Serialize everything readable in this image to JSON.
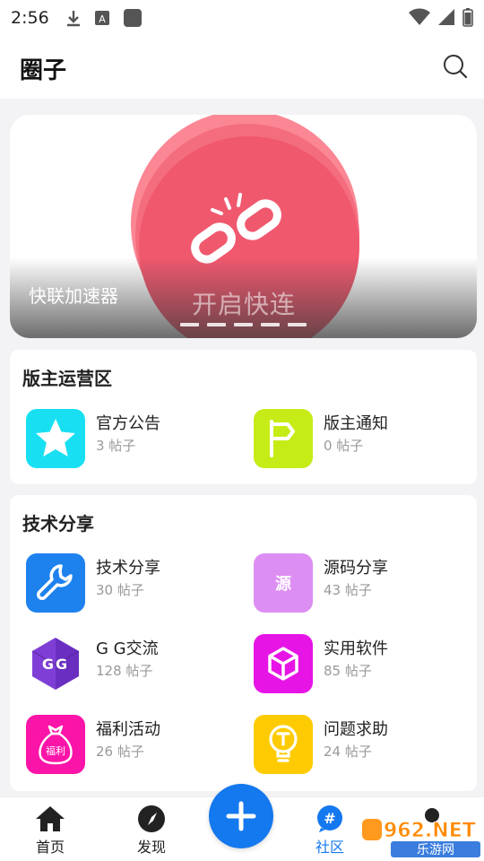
{
  "status": {
    "time": "2:56"
  },
  "header": {
    "title": "圈子"
  },
  "banner": {
    "label": "快联加速器",
    "cta": "开启快连"
  },
  "section1": {
    "title": "版主运营区",
    "items": [
      {
        "name": "官方公告",
        "count": "3 帖子",
        "icon": "star-icon",
        "color": "#18e0f2"
      },
      {
        "name": "版主通知",
        "count": "0 帖子",
        "icon": "flag-icon",
        "color": "#c6ec17"
      }
    ]
  },
  "section2": {
    "title": "技术分享",
    "items": [
      {
        "name": "技术分享",
        "count": "30 帖子",
        "icon": "wrench-icon",
        "color": "#1e82ee"
      },
      {
        "name": "源码分享",
        "count": "43 帖子",
        "icon": "source-icon",
        "color": "#dd8ef3",
        "icon_text": "源"
      },
      {
        "name": "G G交流",
        "count": "128 帖子",
        "icon": "gg-icon",
        "color": "#6a2fc0",
        "icon_text": "GG"
      },
      {
        "name": "实用软件",
        "count": "85 帖子",
        "icon": "cube-icon",
        "color": "#e714e6"
      },
      {
        "name": "福利活动",
        "count": "26 帖子",
        "icon": "money-bag-icon",
        "color": "#fb14a8",
        "icon_text": "福利"
      },
      {
        "name": "问题求助",
        "count": "24 帖子",
        "icon": "bulb-icon",
        "color": "#fecb02"
      }
    ]
  },
  "nav": {
    "home": "首页",
    "discover": "发现",
    "community": "社区",
    "active_color": "#1478ee"
  },
  "watermark": {
    "text_top": "962.NET",
    "text_bottom": "乐游网"
  }
}
